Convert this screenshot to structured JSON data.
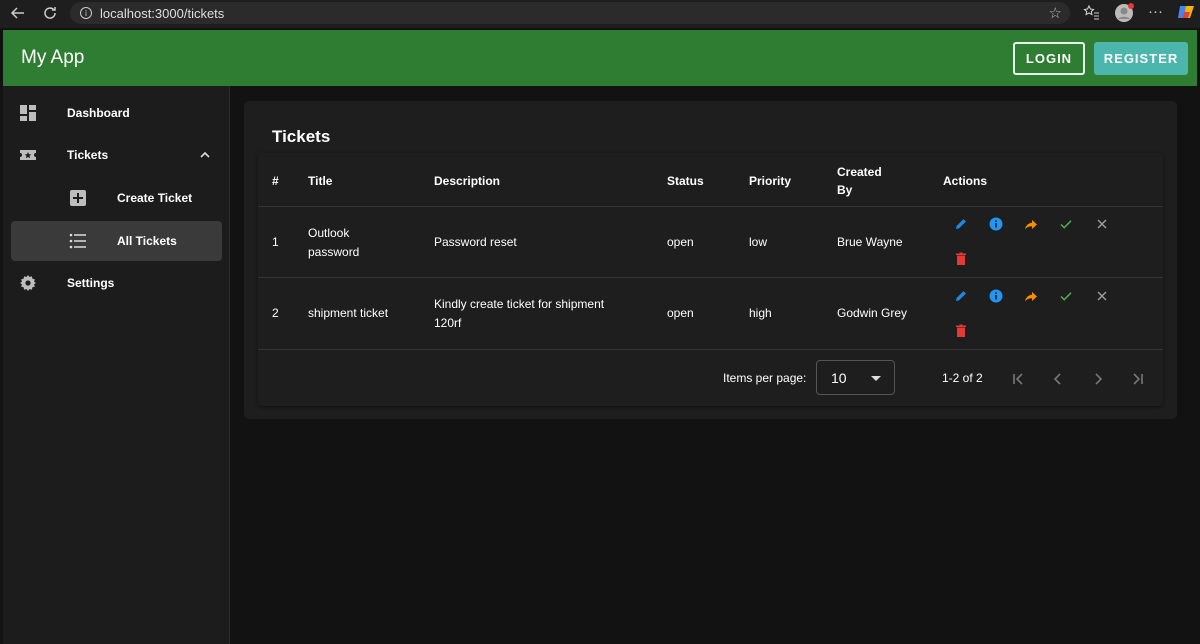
{
  "browser": {
    "url": "localhost:3000/tickets"
  },
  "app": {
    "title": "My App",
    "login_label": "LOGIN",
    "register_label": "REGISTER"
  },
  "sidebar": {
    "items": [
      {
        "label": "Dashboard",
        "icon": "dashboard-icon"
      },
      {
        "label": "Tickets",
        "icon": "ticket-icon"
      },
      {
        "label": "Create Ticket",
        "icon": "add-box-icon"
      },
      {
        "label": "All Tickets",
        "icon": "list-icon"
      },
      {
        "label": "Settings",
        "icon": "gear-icon"
      }
    ]
  },
  "tickets": {
    "title": "Tickets",
    "columns": [
      "#",
      "Title",
      "Description",
      "Status",
      "Priority",
      "Created\nBy",
      "Actions"
    ],
    "rows": [
      {
        "num": "1",
        "title": "Outlook\npassword",
        "description": "Password reset",
        "status": "open",
        "priority": "low",
        "created_by": "Brue Wayne"
      },
      {
        "num": "2",
        "title": "shipment ticket",
        "description": "Kindly create ticket for shipment\n120rf",
        "status": "open",
        "priority": "high",
        "created_by": "Godwin Grey"
      }
    ],
    "action_icons": [
      "edit-icon",
      "info-icon",
      "forward-icon",
      "check-icon",
      "close-icon",
      "delete-icon"
    ]
  },
  "pagination": {
    "items_per_page_label": "Items per page:",
    "items_per_page": "10",
    "range": "1-2 of 2"
  },
  "colors": {
    "appbar": "#2e7d32",
    "register": "#4db6ac",
    "edit": "#1e88e5",
    "info": "#2196f3",
    "forward": "#fb8c00",
    "check": "#4caf50",
    "close": "#9e9e9e",
    "delete": "#e53935"
  }
}
